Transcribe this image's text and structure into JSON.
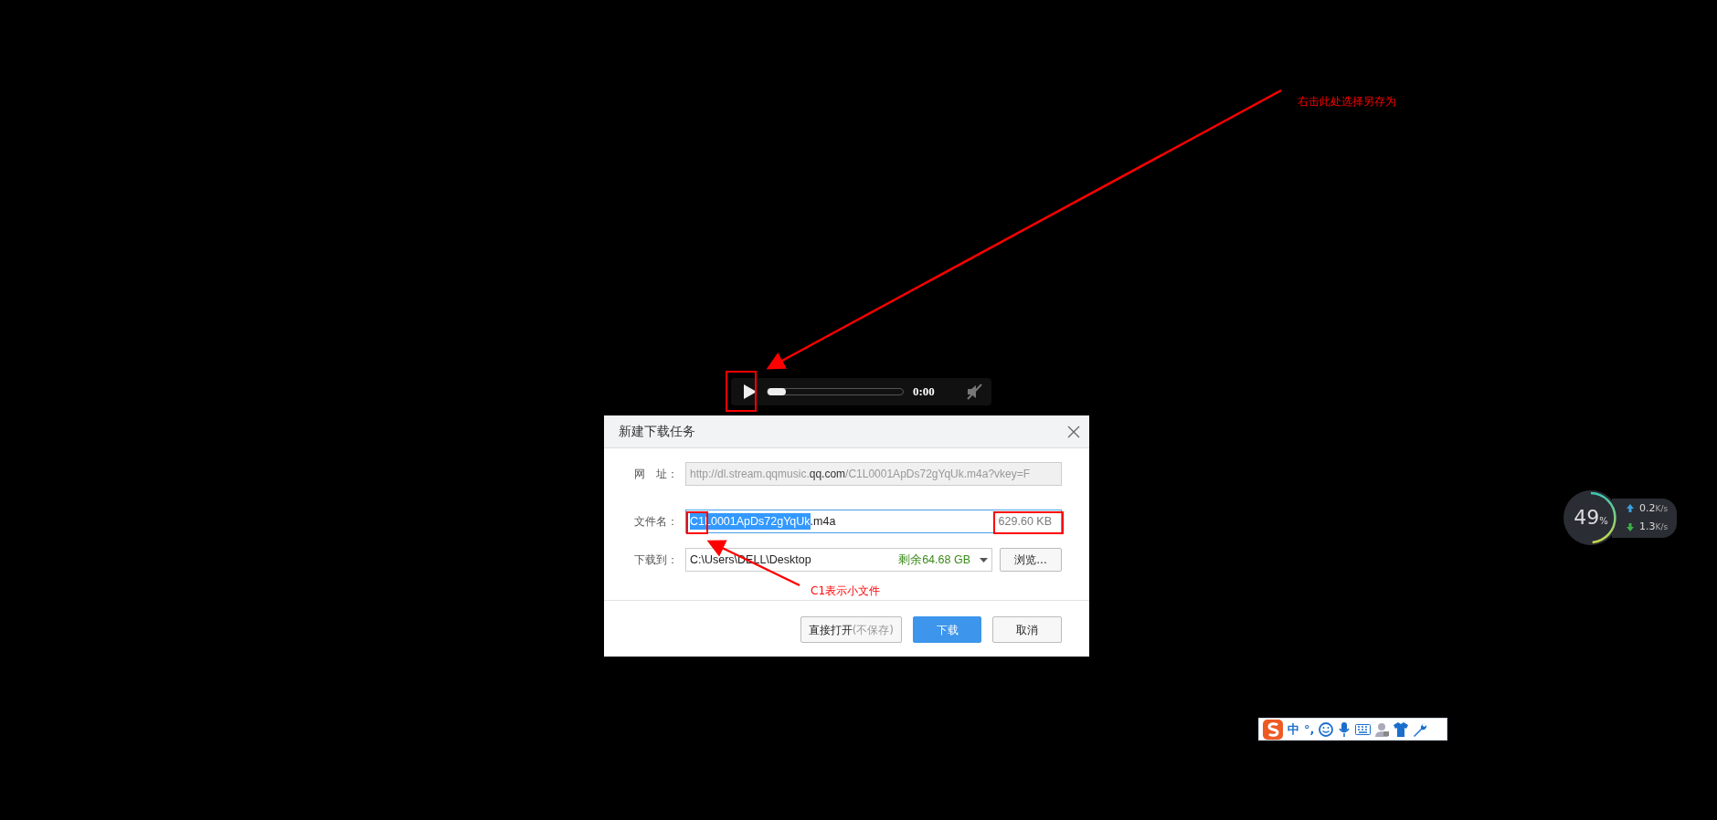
{
  "annotations": [
    {
      "kind": "top",
      "text": "右击此处选择另存为"
    },
    {
      "kind": "bottom",
      "text": "C1表示小文件"
    }
  ],
  "audio_player": {
    "time": "0:00",
    "level": 0,
    "muted": true
  },
  "dialog": {
    "title": "新建下载任务",
    "url": {
      "label": "网　址：",
      "disabled": true,
      "parts": [
        {
          "kind": "path",
          "text": "http://dl.stream.qqmusic."
        },
        {
          "kind": "domain",
          "text": "qq.com"
        },
        {
          "kind": "path",
          "text": "/C1L0001ApDs72gYqUk.m4a?vkey=F"
        }
      ]
    },
    "filename": {
      "label": "文件名：",
      "selected_text": "C1L0001ApDs72gYqUk",
      "text": ".m4a",
      "size": "629.60 KB"
    },
    "destination": {
      "label": "下载到：",
      "path": "C:\\Users\\DELL\\Desktop",
      "free_space": "剩余64.68 GB",
      "browse": "浏览..."
    },
    "buttons": [
      {
        "kind": "secondary",
        "text": "直接打开",
        "note": "(不保存)"
      },
      {
        "kind": "primary",
        "text": "下载"
      },
      {
        "kind": "secondary",
        "text": "取消"
      }
    ]
  },
  "network_monitor": {
    "percent": "49",
    "unit": "%",
    "level": 0.49,
    "upload": "0.2",
    "upload_unit": "K/s",
    "download": "1.3",
    "download_unit": "K/s"
  },
  "ime_toolbar": {
    "mode": "中",
    "punctuation": "°,"
  }
}
